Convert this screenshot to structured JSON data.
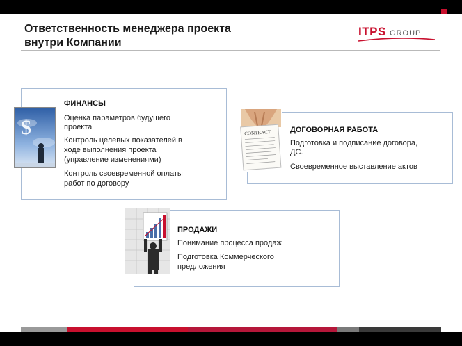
{
  "slide": {
    "title_line1": "Ответственность менеджера проекта",
    "title_line2": "внутри Компании",
    "logo": {
      "main": "ITPS",
      "sub": "GROUP"
    }
  },
  "cards": {
    "finance": {
      "heading": "ФИНАНСЫ",
      "lines": [
        "Оценка параметров будущего",
        "проекта",
        "Контроль целевых показателей в",
        "ходе выполнения проекта",
        "(управление изменениями)",
        "Контроль своевременной оплаты",
        "работ по договору"
      ]
    },
    "contract": {
      "heading": "ДОГОВОРНАЯ РАБОТА",
      "lines": [
        "Подготовка и подписание договора,",
        "ДС.",
        "Своевременное выставление актов"
      ],
      "image_caption": "CONTRACT"
    },
    "sales": {
      "heading": "ПРОДАЖИ",
      "lines": [
        "Понимание процесса продаж",
        "Подготовка Коммерческого",
        "предложения"
      ]
    }
  },
  "icons": {
    "finance": "dollar-businessman-image",
    "contract": "contract-handshake-image",
    "sales": "sales-chart-image"
  },
  "colors": {
    "accent_red": "#c8102e",
    "card_border": "#a8bcd6",
    "footer": [
      "#9a9a9a",
      "#c8102e",
      "#b5173a",
      "#7a7a7a",
      "#3a3a3a"
    ]
  }
}
